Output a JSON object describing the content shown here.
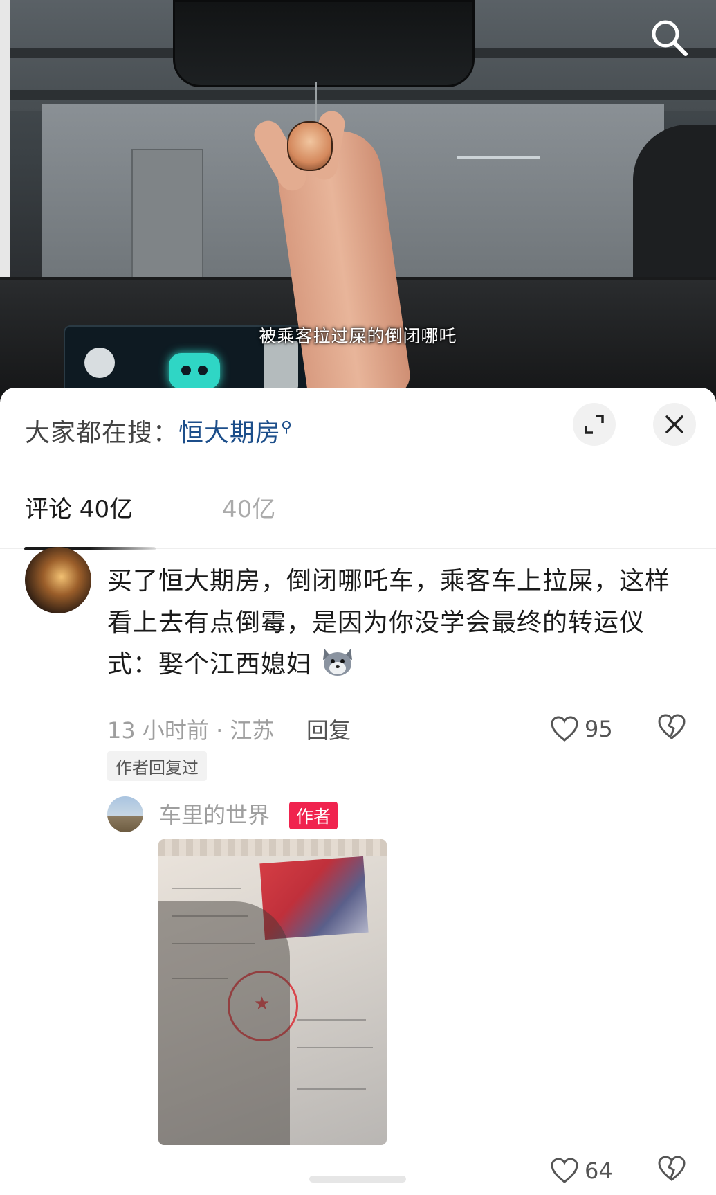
{
  "video": {
    "subtitle": "被乘客拉过屎的倒闭哪吒",
    "search_icon": "search-icon"
  },
  "sheet": {
    "hot_search_prefix": "大家都在搜：",
    "hot_search_term": "恒大期房",
    "expand_icon": "expand-icon",
    "close_icon": "close-icon"
  },
  "tabs": {
    "active_label": "评论 40亿",
    "inactive_label": "40亿"
  },
  "comment": {
    "text": "买了恒大期房，倒闭哪吒车，乘客车上拉屎，这样看上去有点倒霉，是因为你没学会最终的转运仪式：娶个江西媳妇",
    "emoji": "wolf-emoji",
    "time": "13 小时前",
    "location": "江苏",
    "meta": "13 小时前 · 江苏",
    "reply_label": "回复",
    "like_count": "95",
    "author_replied_label": "作者回复过"
  },
  "reply": {
    "author_name": "车里的世界",
    "author_badge": "作者",
    "image": "marriage-certificate-photo",
    "like_count": "64"
  },
  "colors": {
    "badge_red": "#f0234e",
    "link_blue": "#1c4e8a",
    "meta_gray": "#9e9e9e"
  }
}
